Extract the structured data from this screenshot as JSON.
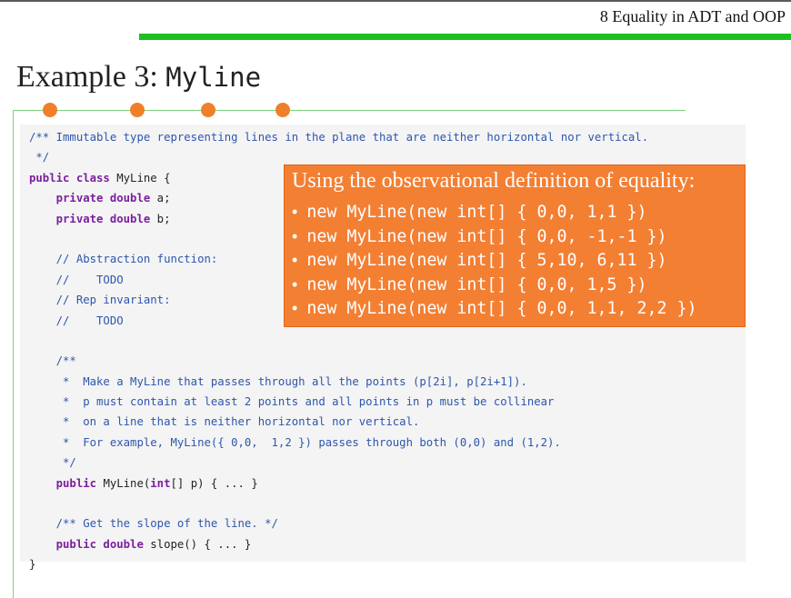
{
  "header": {
    "lecture_title": "8 Equality in ADT and OOP"
  },
  "slide": {
    "title_text": "Example 3: ",
    "title_code": "Myline"
  },
  "colors": {
    "green_bar": "#1fbf1f",
    "dot": "#f07f2a",
    "callout_bg": "#f37f33",
    "code_bg": "#f4f4f4",
    "comment": "#2e56ad",
    "keyword": "#7c1f9e"
  },
  "code": {
    "lines": [
      [
        {
          "t": "/** Immutable type representing lines in the plane that are neither horizontal nor vertical.",
          "c": "cm"
        }
      ],
      [
        {
          "t": " */",
          "c": "cm"
        }
      ],
      [
        {
          "t": "public class ",
          "c": "kw"
        },
        {
          "t": "MyLine {",
          "c": "pl"
        }
      ],
      [
        {
          "t": "    private double ",
          "c": "kw"
        },
        {
          "t": "a;",
          "c": "pl"
        }
      ],
      [
        {
          "t": "    private double ",
          "c": "kw"
        },
        {
          "t": "b;",
          "c": "pl"
        }
      ],
      [],
      [
        {
          "t": "    // Abstraction function:",
          "c": "cm"
        }
      ],
      [
        {
          "t": "    //    TODO",
          "c": "cm"
        }
      ],
      [
        {
          "t": "    // Rep invariant:",
          "c": "cm"
        }
      ],
      [
        {
          "t": "    //    TODO",
          "c": "cm"
        }
      ],
      [],
      [
        {
          "t": "    /**",
          "c": "cm"
        }
      ],
      [
        {
          "t": "     *  Make a MyLine that passes through all the points (p[2i], p[2i+1]).",
          "c": "cm"
        }
      ],
      [
        {
          "t": "     *  p must contain at least 2 points and all points in p must be collinear",
          "c": "cm"
        }
      ],
      [
        {
          "t": "     *  on a line that is neither horizontal nor vertical.",
          "c": "cm"
        }
      ],
      [
        {
          "t": "     *  For example, MyLine({ 0,0,  1,2 }) passes through both (0,0) and (1,2).",
          "c": "cm"
        }
      ],
      [
        {
          "t": "     */",
          "c": "cm"
        }
      ],
      [
        {
          "t": "    public ",
          "c": "kw"
        },
        {
          "t": "MyLine(",
          "c": "pl"
        },
        {
          "t": "int",
          "c": "kw"
        },
        {
          "t": "[] p) { ... }",
          "c": "pl"
        }
      ],
      [],
      [
        {
          "t": "    /** Get the slope of the line. */",
          "c": "cm"
        }
      ],
      [
        {
          "t": "    public double ",
          "c": "kw"
        },
        {
          "t": "slope() { ... }",
          "c": "pl"
        }
      ],
      [
        {
          "t": "}",
          "c": "pl"
        }
      ]
    ]
  },
  "callout": {
    "heading": "Using the observational definition of equality:",
    "bullet": "•",
    "items": [
      "new MyLine(new int[] { 0,0, 1,1 })",
      "new MyLine(new int[] { 0,0, -1,-1 })",
      "new MyLine(new int[] { 5,10, 6,11 })",
      "new MyLine(new int[] { 0,0, 1,5 })",
      "new MyLine(new int[] { 0,0, 1,1, 2,2 })"
    ]
  }
}
